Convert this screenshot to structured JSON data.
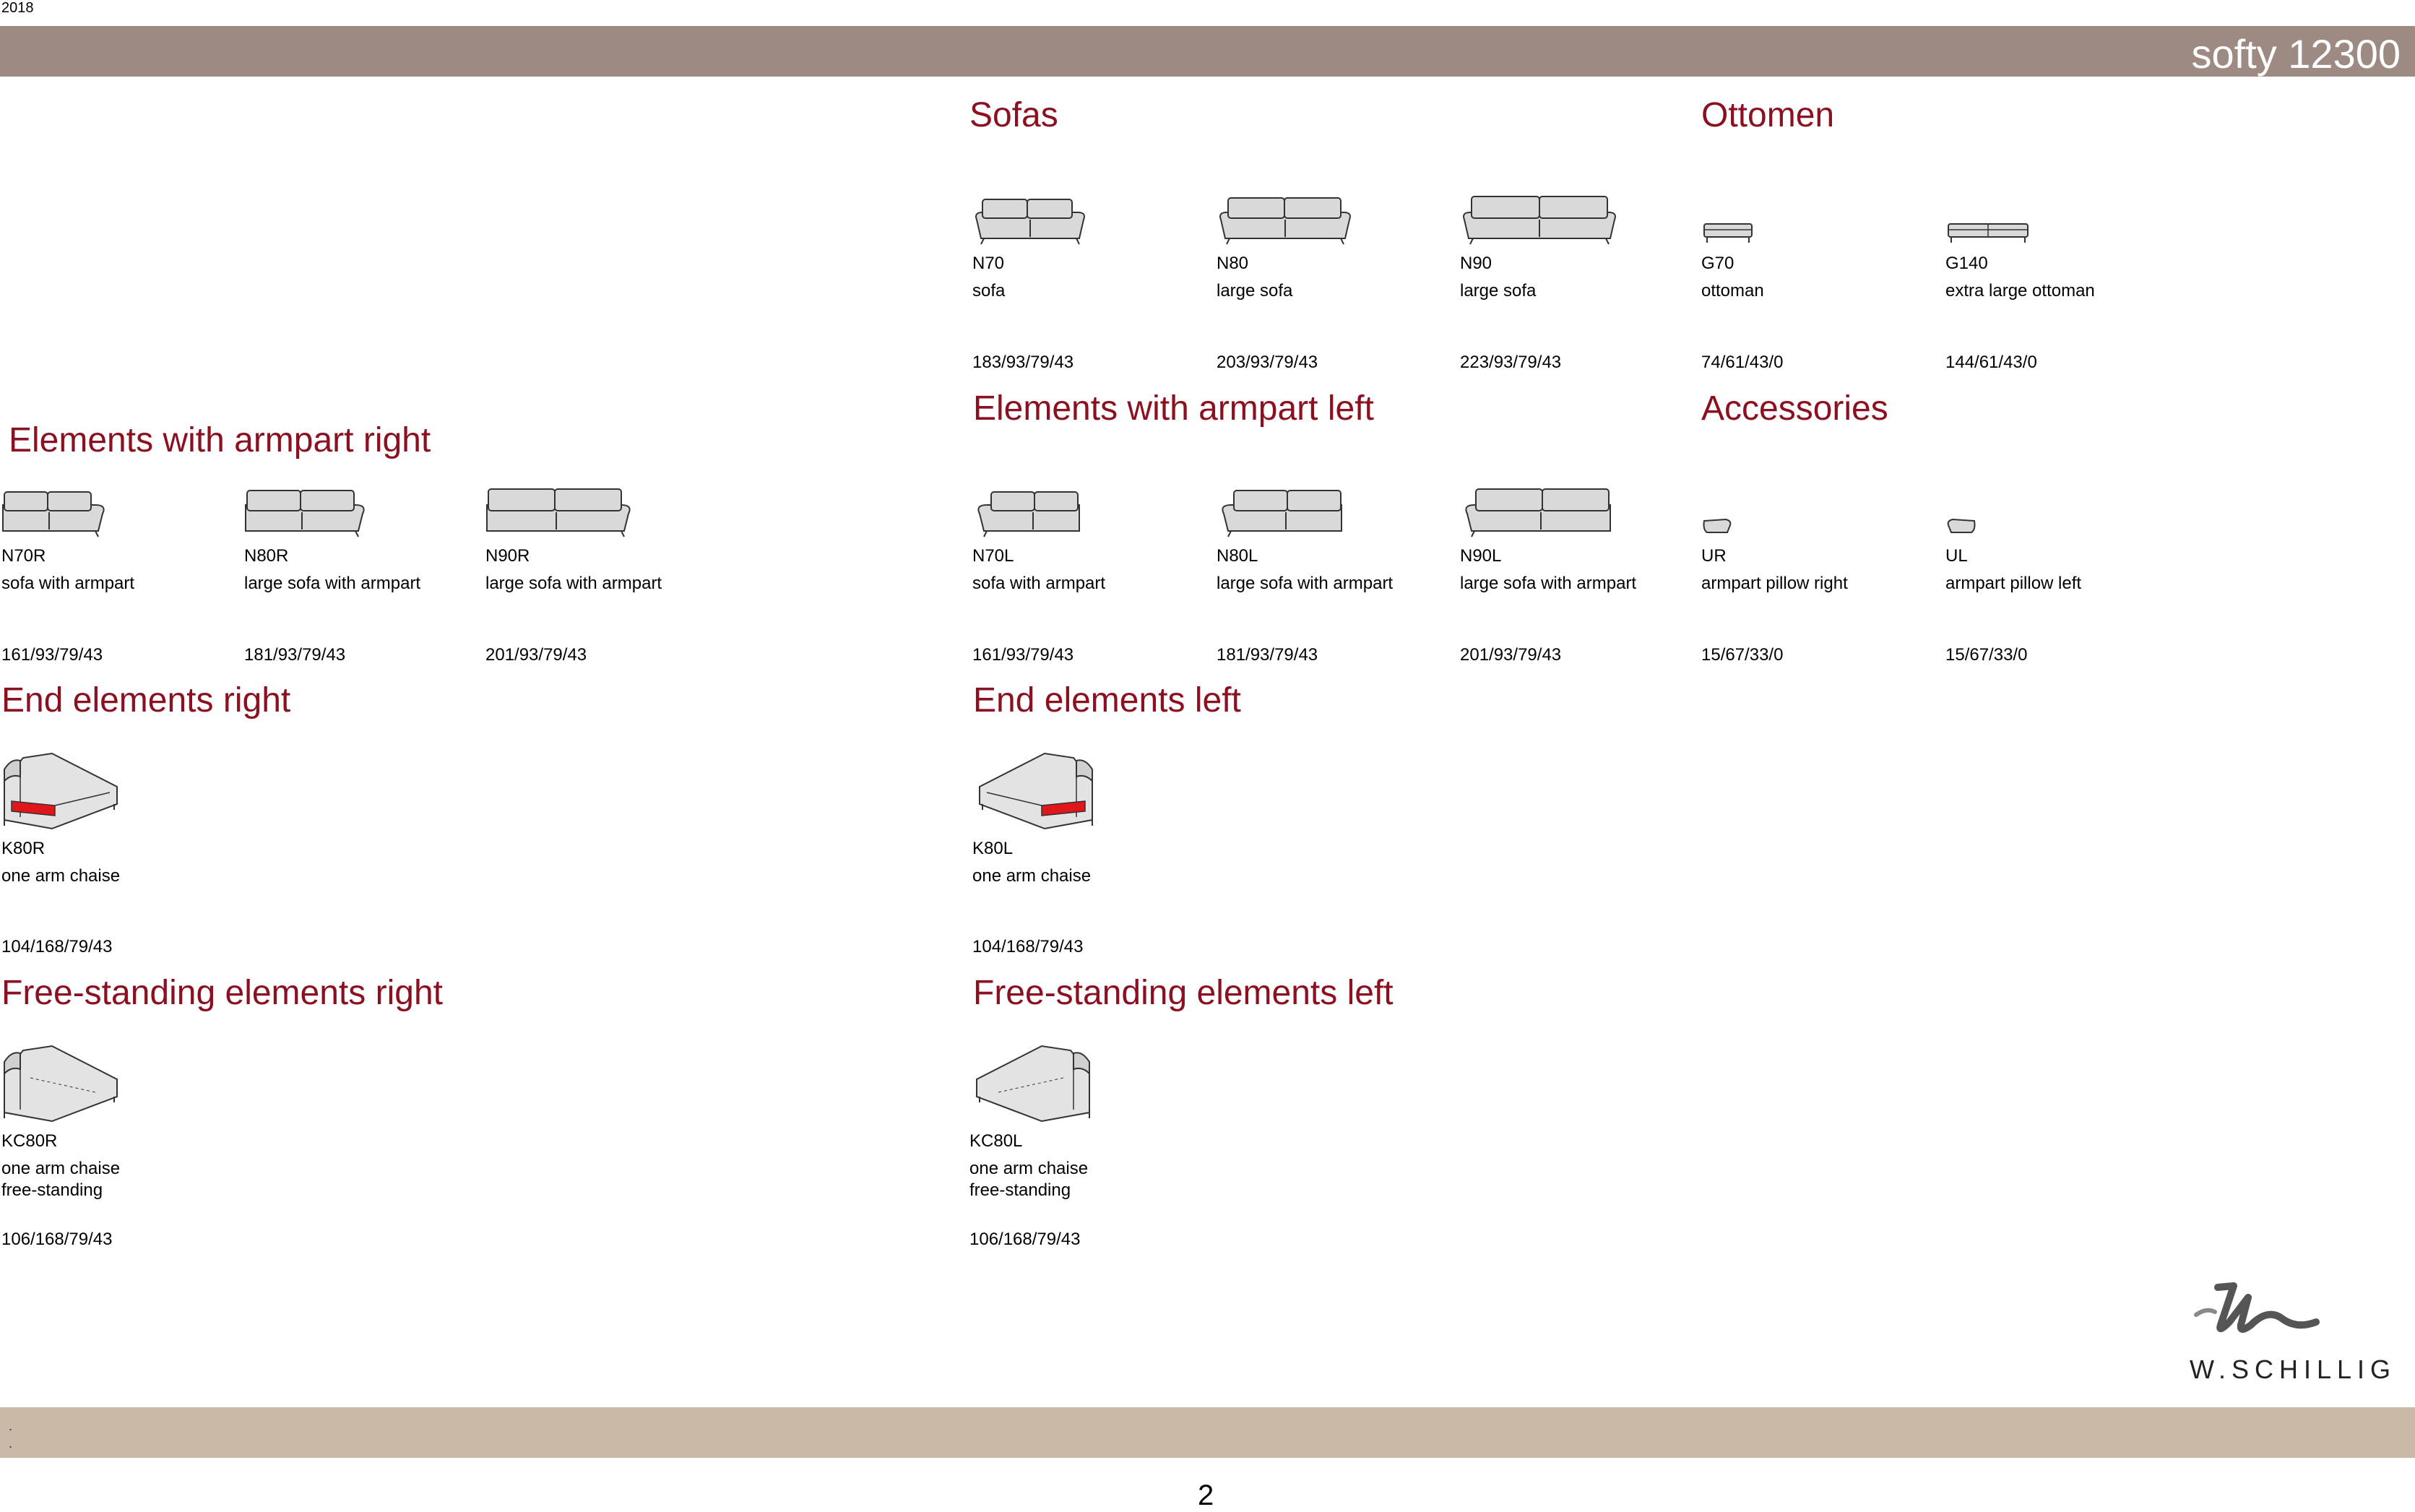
{
  "header": {
    "year": "2018",
    "title": "softy 12300"
  },
  "sections": {
    "sofas": "Sofas",
    "ottomen": "Ottomen",
    "armpart_right": "Elements with armpart right",
    "armpart_left": "Elements with armpart left",
    "accessories": "Accessories",
    "end_right": "End elements right",
    "end_left": "End elements left",
    "free_right": "Free-standing elements right",
    "free_left": "Free-standing elements left"
  },
  "items": {
    "n70": {
      "code": "N70",
      "desc": "sofa",
      "dims": "183/93/79/43"
    },
    "n80": {
      "code": "N80",
      "desc": "large sofa",
      "dims": "203/93/79/43"
    },
    "n90": {
      "code": "N90",
      "desc": "large sofa",
      "dims": "223/93/79/43"
    },
    "g70": {
      "code": "G70",
      "desc": "ottoman",
      "dims": "74/61/43/0"
    },
    "g140": {
      "code": "G140",
      "desc": "extra large ottoman",
      "dims": "144/61/43/0"
    },
    "n70r": {
      "code": "N70R",
      "desc": "sofa with armpart",
      "dims": "161/93/79/43"
    },
    "n80r": {
      "code": "N80R",
      "desc": "large sofa with armpart",
      "dims": "181/93/79/43"
    },
    "n90r": {
      "code": "N90R",
      "desc": "large sofa with armpart",
      "dims": "201/93/79/43"
    },
    "n70l": {
      "code": "N70L",
      "desc": "sofa with armpart",
      "dims": "161/93/79/43"
    },
    "n80l": {
      "code": "N80L",
      "desc": "large sofa with armpart",
      "dims": "181/93/79/43"
    },
    "n90l": {
      "code": "N90L",
      "desc": "large sofa with armpart",
      "dims": "201/93/79/43"
    },
    "ur": {
      "code": "UR",
      "desc": "armpart pillow right",
      "dims": "15/67/33/0"
    },
    "ul": {
      "code": "UL",
      "desc": "armpart pillow left",
      "dims": "15/67/33/0"
    },
    "k80r": {
      "code": "K80R",
      "desc": "one arm chaise",
      "dims": "104/168/79/43"
    },
    "k80l": {
      "code": "K80L",
      "desc": "one arm chaise",
      "dims": "104/168/79/43"
    },
    "kc80r": {
      "code": "KC80R",
      "desc": "one arm chaise",
      "desc2": "free-standing",
      "dims": "106/168/79/43"
    },
    "kc80l": {
      "code": "KC80L",
      "desc": "one arm chaise",
      "desc2": "free-standing",
      "dims": "106/168/79/43"
    }
  },
  "logo": {
    "text": "W.SCHILLIG"
  },
  "footer": {
    "dot1": ".",
    "dot2": ".",
    "page": "2"
  },
  "colors": {
    "header_bar": "#9d8a83",
    "footer_bar": "#c9b9a6",
    "section_title": "#8b1020",
    "highlight": "#e0161b"
  }
}
